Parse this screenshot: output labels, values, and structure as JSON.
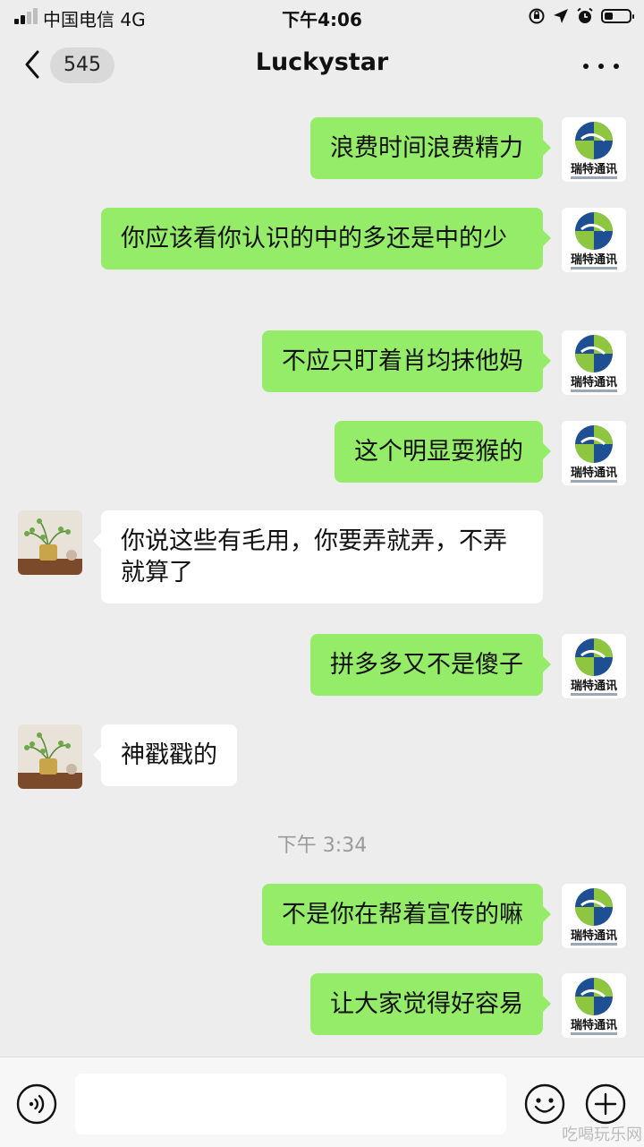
{
  "status_bar": {
    "carrier": "中国电信 4G",
    "time": "下午4:06"
  },
  "nav": {
    "unread_count": "545",
    "title": "Luckystar"
  },
  "messages": [
    {
      "side": "out",
      "text": "浪费时间浪费精力"
    },
    {
      "side": "out",
      "text": "你应该看你认识的中的多还是中的少"
    },
    {
      "side": "out",
      "text": "不应只盯着肖均抹他妈"
    },
    {
      "side": "out",
      "text": "这个明显耍猴的"
    },
    {
      "side": "in",
      "text": "你说这些有毛用，你要弄就弄，不弄就算了"
    },
    {
      "side": "out",
      "text": "拼多多又不是傻子"
    },
    {
      "side": "in",
      "text": "神戳戳的"
    },
    {
      "type": "timestamp",
      "text": "下午 3:34"
    },
    {
      "side": "out",
      "text": "不是你在帮着宣传的嘛"
    },
    {
      "side": "out",
      "text": "让大家觉得好容易"
    }
  ],
  "own_avatar": {
    "logo_text": "瑞特通讯"
  },
  "input_bar": {
    "placeholder": ""
  },
  "watermark": "吃喝玩乐网",
  "colors": {
    "outgoing_bubble": "#95ec69",
    "incoming_bubble": "#ffffff",
    "background": "#ededed"
  },
  "icons": [
    "signal-icon",
    "back-chevron-icon",
    "more-dots-icon",
    "voice-icon",
    "emoji-icon",
    "plus-icon"
  ]
}
